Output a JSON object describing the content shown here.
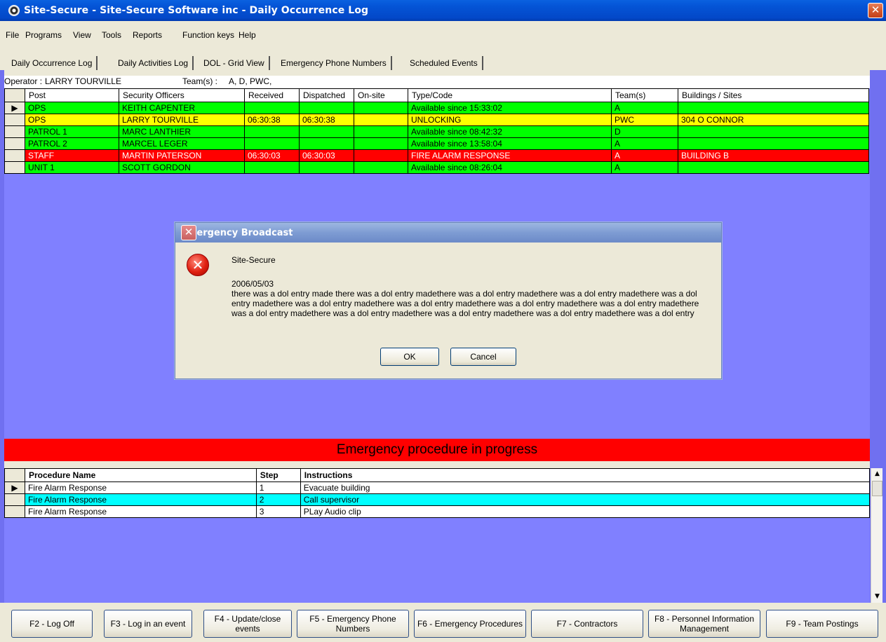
{
  "window": {
    "title": "Site-Secure - Site-Secure Software inc - Daily Occurrence Log",
    "close_glyph": "✕"
  },
  "menu": [
    "File",
    "Programs",
    "View",
    "Tools",
    "Reports",
    "Function keys",
    "Help"
  ],
  "tabs": [
    "Daily Occurrence Log",
    "Daily Activities Log",
    "DOL - Grid View",
    "Emergency Phone Numbers",
    "Scheduled Events"
  ],
  "operator": {
    "label": "Operator :",
    "name": "LARRY TOURVILLE",
    "teams_label": "Team(s) :",
    "teams": "A, D, PWC,"
  },
  "grid": {
    "columns": [
      "Post",
      "Security Officers",
      "Received",
      "Dispatched",
      "On-site",
      "Type/Code",
      "Team(s)",
      "Buildings / Sites"
    ],
    "rows": [
      {
        "post": "OPS",
        "officer": "KEITH CAPENTER",
        "received": "",
        "dispatched": "",
        "onsite": "",
        "type": "Available since 15:33:02",
        "team": "A",
        "building": "",
        "status": "green",
        "current": "▶"
      },
      {
        "post": "OPS",
        "officer": "LARRY TOURVILLE",
        "received": "06:30:38",
        "dispatched": "06:30:38",
        "onsite": "",
        "type": "UNLOCKING",
        "team": "PWC",
        "building": "304 O CONNOR",
        "status": "yellow",
        "current": ""
      },
      {
        "post": "PATROL 1",
        "officer": "MARC LANTHIER",
        "received": "",
        "dispatched": "",
        "onsite": "",
        "type": "Available since 08:42:32",
        "team": "D",
        "building": "",
        "status": "green",
        "current": ""
      },
      {
        "post": "PATROL 2",
        "officer": "MARCEL LEGER",
        "received": "",
        "dispatched": "",
        "onsite": "",
        "type": "Available since 13:58:04",
        "team": "A",
        "building": "",
        "status": "green",
        "current": ""
      },
      {
        "post": "STAFF",
        "officer": "MARTIN PATERSON",
        "received": "06:30:03",
        "dispatched": "06:30:03",
        "onsite": "",
        "type": "FIRE ALARM RESPONSE",
        "team": "A",
        "building": "BUILDING B",
        "status": "red",
        "current": ""
      },
      {
        "post": "UNIT 1",
        "officer": "SCOTT GORDON",
        "received": "",
        "dispatched": "",
        "onsite": "",
        "type": "Available since 08:26:04",
        "team": "A",
        "building": "",
        "status": "green",
        "current": ""
      }
    ]
  },
  "dialog": {
    "title": "Emergency Broadcast",
    "icon_glyph": "✕",
    "sender": "Site-Secure",
    "date": "2006/05/03",
    "message": "there was a dol entry made there was a dol entry madethere was a dol entry madethere was a dol entry madethere was a dol entry madethere was a dol entry madethere was a dol entry madethere was a dol entry madethere was a dol entry madethere was a dol entry madethere was a dol entry madethere was a dol entry madethere was a dol entry madethere was a dol entry",
    "ok_label": "OK",
    "cancel_label": "Cancel"
  },
  "emergency_banner": "Emergency procedure in progress",
  "procedures": {
    "columns": [
      "Procedure Name",
      "Step",
      "Instructions"
    ],
    "rows": [
      {
        "name": "Fire Alarm Response",
        "step": "1",
        "instruction": "Evacuate building",
        "highlight": "white",
        "current": "▶"
      },
      {
        "name": "Fire Alarm Response",
        "step": "2",
        "instruction": "Call supervisor",
        "highlight": "cyan",
        "current": ""
      },
      {
        "name": "Fire Alarm Response",
        "step": "3",
        "instruction": "PLay Audio clip",
        "highlight": "white",
        "current": ""
      }
    ]
  },
  "scroll": {
    "up": "▲",
    "down": "▼"
  },
  "function_keys": [
    "F2 - Log Off",
    "F3 - Log in an event",
    "F4 - Update/close events",
    "F5 - Emergency Phone Numbers",
    "F6 - Emergency Procedures",
    "F7 - Contractors",
    "F8 - Personnel Information Management",
    "F9 - Team Postings"
  ],
  "colors": {
    "green": "#00ff00",
    "yellow": "#ffff00",
    "red": "#ff0000",
    "cyan": "#00ffff",
    "background": "#8080ff"
  }
}
